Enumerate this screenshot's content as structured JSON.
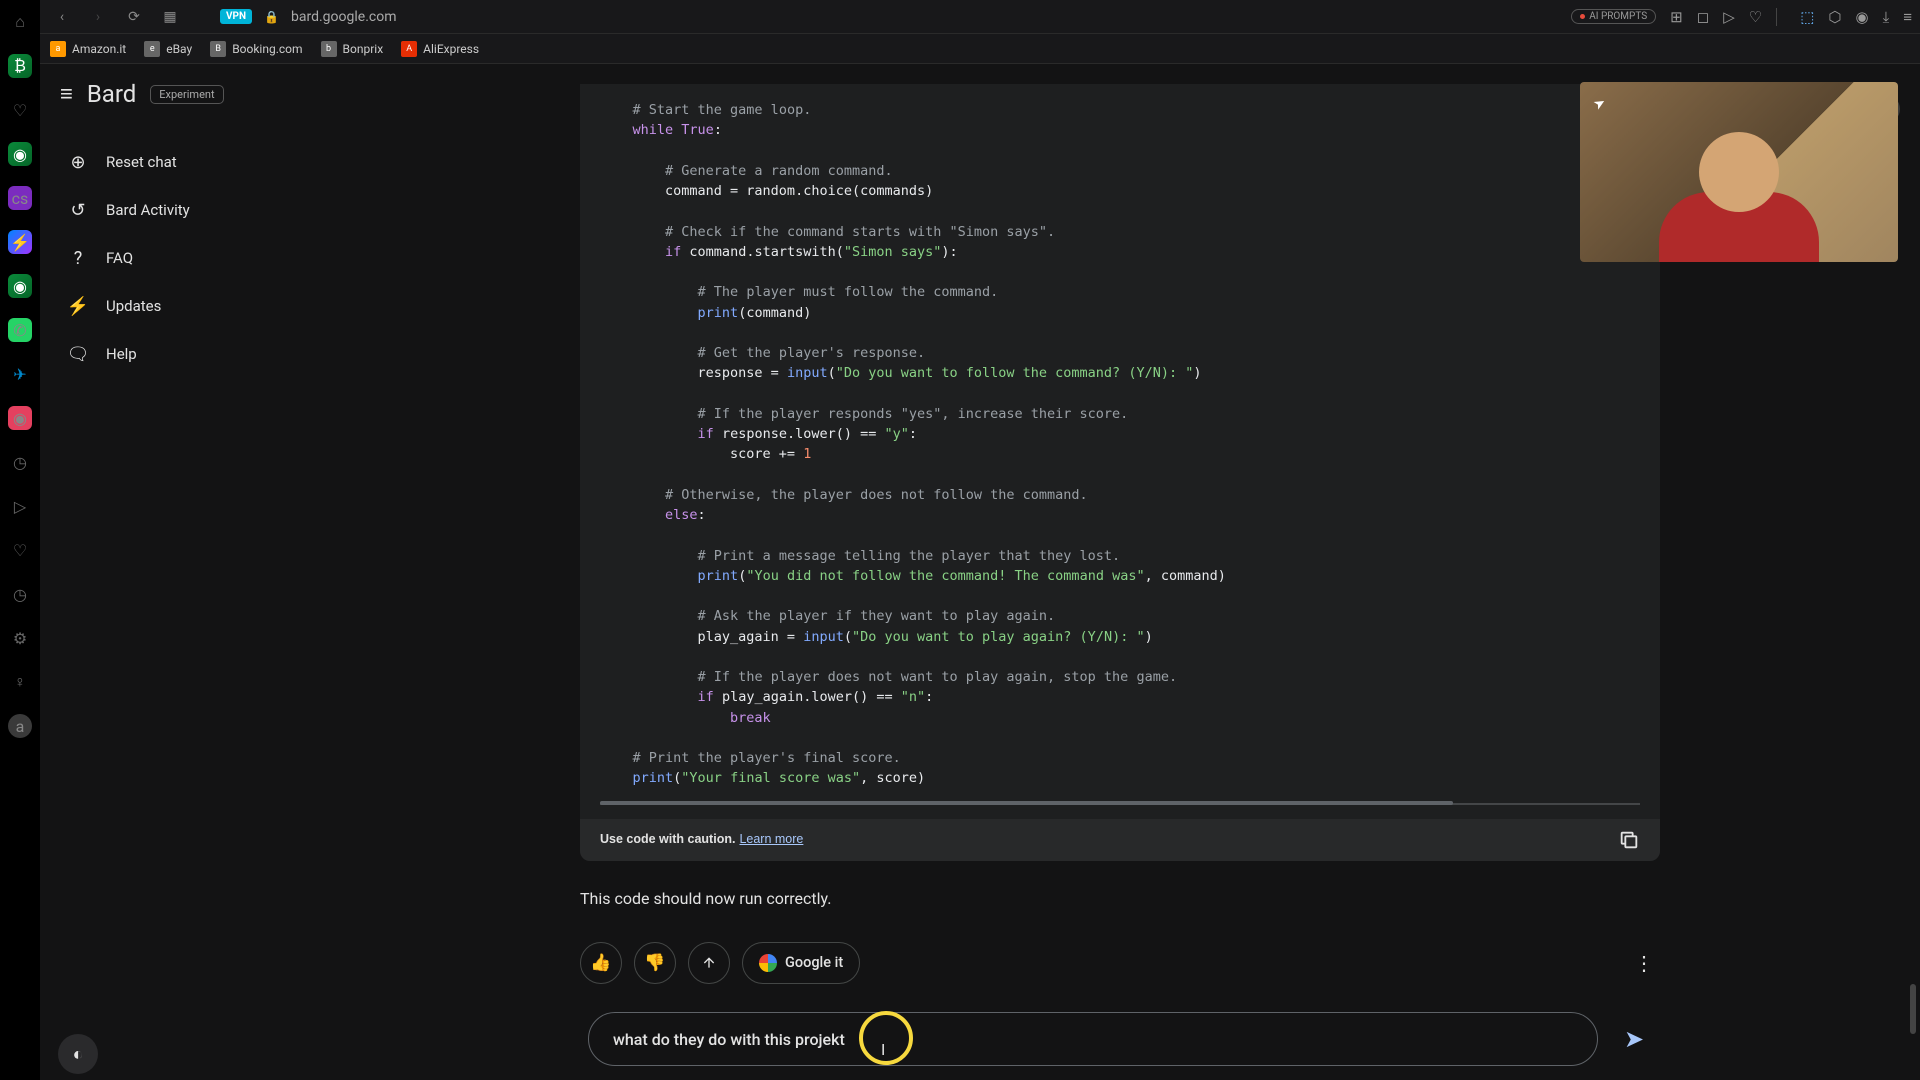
{
  "browser": {
    "url": "bard.google.com",
    "vpn": "VPN",
    "ai_prompts": "AI PROMPTS"
  },
  "bookmarks": [
    {
      "label": "Amazon.it",
      "icon": "a"
    },
    {
      "label": "eBay",
      "icon": "e"
    },
    {
      "label": "Booking.com",
      "icon": "B"
    },
    {
      "label": "Bonprix",
      "icon": "b"
    },
    {
      "label": "AliExpress",
      "icon": "A"
    }
  ],
  "bard": {
    "logo": "Bard",
    "experiment": "Experiment",
    "sidebar": [
      {
        "icon": "add",
        "label": "Reset chat"
      },
      {
        "icon": "history",
        "label": "Bard Activity"
      },
      {
        "icon": "help",
        "label": "FAQ"
      },
      {
        "icon": "bolt",
        "label": "Updates"
      },
      {
        "icon": "support",
        "label": "Help"
      }
    ]
  },
  "code": {
    "lines": [
      {
        "indent": 1,
        "tokens": [
          {
            "t": "comment",
            "v": "# Start the game loop."
          }
        ]
      },
      {
        "indent": 1,
        "tokens": [
          {
            "t": "kw",
            "v": "while"
          },
          {
            "t": "plain",
            "v": " "
          },
          {
            "t": "bool",
            "v": "True"
          },
          {
            "t": "plain",
            "v": ":"
          }
        ]
      },
      {
        "indent": 0,
        "tokens": []
      },
      {
        "indent": 2,
        "tokens": [
          {
            "t": "comment",
            "v": "# Generate a random command."
          }
        ]
      },
      {
        "indent": 2,
        "tokens": [
          {
            "t": "plain",
            "v": "command = random.choice(commands)"
          }
        ]
      },
      {
        "indent": 0,
        "tokens": []
      },
      {
        "indent": 2,
        "tokens": [
          {
            "t": "comment",
            "v": "# Check if the command starts with \"Simon says\"."
          }
        ]
      },
      {
        "indent": 2,
        "tokens": [
          {
            "t": "kw",
            "v": "if"
          },
          {
            "t": "plain",
            "v": " command.startswith("
          },
          {
            "t": "str",
            "v": "\"Simon says\""
          },
          {
            "t": "plain",
            "v": "):"
          }
        ]
      },
      {
        "indent": 0,
        "tokens": []
      },
      {
        "indent": 3,
        "tokens": [
          {
            "t": "comment",
            "v": "# The player must follow the command."
          }
        ]
      },
      {
        "indent": 3,
        "tokens": [
          {
            "t": "func",
            "v": "print"
          },
          {
            "t": "plain",
            "v": "(command)"
          }
        ]
      },
      {
        "indent": 0,
        "tokens": []
      },
      {
        "indent": 3,
        "tokens": [
          {
            "t": "comment",
            "v": "# Get the player's response."
          }
        ]
      },
      {
        "indent": 3,
        "tokens": [
          {
            "t": "plain",
            "v": "response = "
          },
          {
            "t": "func",
            "v": "input"
          },
          {
            "t": "plain",
            "v": "("
          },
          {
            "t": "str",
            "v": "\"Do you want to follow the command? (Y/N): \""
          },
          {
            "t": "plain",
            "v": ")"
          }
        ]
      },
      {
        "indent": 0,
        "tokens": []
      },
      {
        "indent": 3,
        "tokens": [
          {
            "t": "comment",
            "v": "# If the player responds \"yes\", increase their score."
          }
        ]
      },
      {
        "indent": 3,
        "tokens": [
          {
            "t": "kw",
            "v": "if"
          },
          {
            "t": "plain",
            "v": " response.lower() == "
          },
          {
            "t": "str",
            "v": "\"y\""
          },
          {
            "t": "plain",
            "v": ":"
          }
        ]
      },
      {
        "indent": 4,
        "tokens": [
          {
            "t": "plain",
            "v": "score += "
          },
          {
            "t": "num",
            "v": "1"
          }
        ]
      },
      {
        "indent": 0,
        "tokens": []
      },
      {
        "indent": 2,
        "tokens": [
          {
            "t": "comment",
            "v": "# Otherwise, the player does not follow the command."
          }
        ]
      },
      {
        "indent": 2,
        "tokens": [
          {
            "t": "kw",
            "v": "else"
          },
          {
            "t": "plain",
            "v": ":"
          }
        ]
      },
      {
        "indent": 0,
        "tokens": []
      },
      {
        "indent": 3,
        "tokens": [
          {
            "t": "comment",
            "v": "# Print a message telling the player that they lost."
          }
        ]
      },
      {
        "indent": 3,
        "tokens": [
          {
            "t": "func",
            "v": "print"
          },
          {
            "t": "plain",
            "v": "("
          },
          {
            "t": "str",
            "v": "\"You did not follow the command! The command was\""
          },
          {
            "t": "plain",
            "v": ", command)"
          }
        ]
      },
      {
        "indent": 0,
        "tokens": []
      },
      {
        "indent": 3,
        "tokens": [
          {
            "t": "comment",
            "v": "# Ask the player if they want to play again."
          }
        ]
      },
      {
        "indent": 3,
        "tokens": [
          {
            "t": "plain",
            "v": "play_again = "
          },
          {
            "t": "func",
            "v": "input"
          },
          {
            "t": "plain",
            "v": "("
          },
          {
            "t": "str",
            "v": "\"Do you want to play again? (Y/N): \""
          },
          {
            "t": "plain",
            "v": ")"
          }
        ]
      },
      {
        "indent": 0,
        "tokens": []
      },
      {
        "indent": 3,
        "tokens": [
          {
            "t": "comment",
            "v": "# If the player does not want to play again, stop the game."
          }
        ]
      },
      {
        "indent": 3,
        "tokens": [
          {
            "t": "kw",
            "v": "if"
          },
          {
            "t": "plain",
            "v": " play_again.lower() == "
          },
          {
            "t": "str",
            "v": "\"n\""
          },
          {
            "t": "plain",
            "v": ":"
          }
        ]
      },
      {
        "indent": 4,
        "tokens": [
          {
            "t": "kw",
            "v": "break"
          }
        ]
      },
      {
        "indent": 0,
        "tokens": []
      },
      {
        "indent": 1,
        "tokens": [
          {
            "t": "comment",
            "v": "# Print the player's final score."
          }
        ]
      },
      {
        "indent": 1,
        "tokens": [
          {
            "t": "func",
            "v": "print"
          },
          {
            "t": "plain",
            "v": "("
          },
          {
            "t": "str",
            "v": "\"Your final score was\""
          },
          {
            "t": "plain",
            "v": ", score)"
          }
        ]
      }
    ]
  },
  "caution": {
    "text": "Use code with caution.",
    "link": "Learn more"
  },
  "post_text": "This code should now run correctly.",
  "actions": {
    "google_it": "Google it"
  },
  "input": {
    "value": "what do they do with this projekt"
  },
  "avatar": "a"
}
